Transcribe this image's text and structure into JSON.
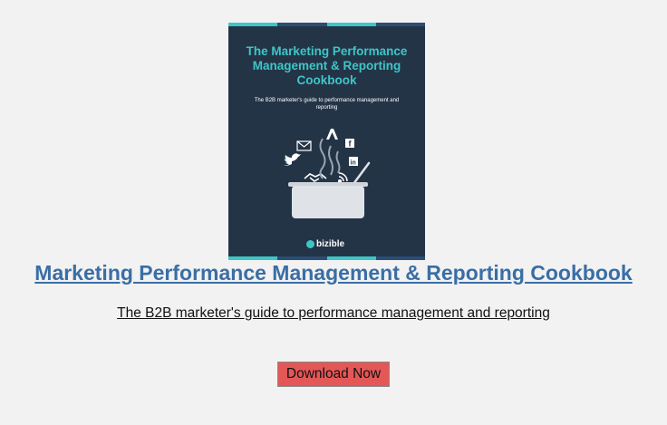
{
  "cover": {
    "title": "The Marketing Performance Management & Reporting Cookbook",
    "subtitle": "The B2B marketer's guide to performance management and reporting",
    "logo_text": "bizible",
    "colors": {
      "background": "#243447",
      "title": "#3ec6c6",
      "strip": [
        "#3ec6c6",
        "#2a4d75",
        "#3ec6c6",
        "#2a4d75"
      ]
    },
    "icons": [
      "envelope-icon",
      "a-logo-icon",
      "facebook-icon",
      "twitter-icon",
      "linkedin-icon",
      "handshake-icon",
      "rss-icon",
      "steam-icon",
      "pot-icon",
      "ladle-icon"
    ]
  },
  "headline": "Marketing Performance Management & Reporting Cookbook",
  "subheadline": "The B2B marketer's guide to performance management and reporting",
  "cta": {
    "label": "Download Now",
    "color": "#e45757"
  },
  "colors": {
    "page_background": "#f2f2f2",
    "headline": "#3a6ea5"
  }
}
